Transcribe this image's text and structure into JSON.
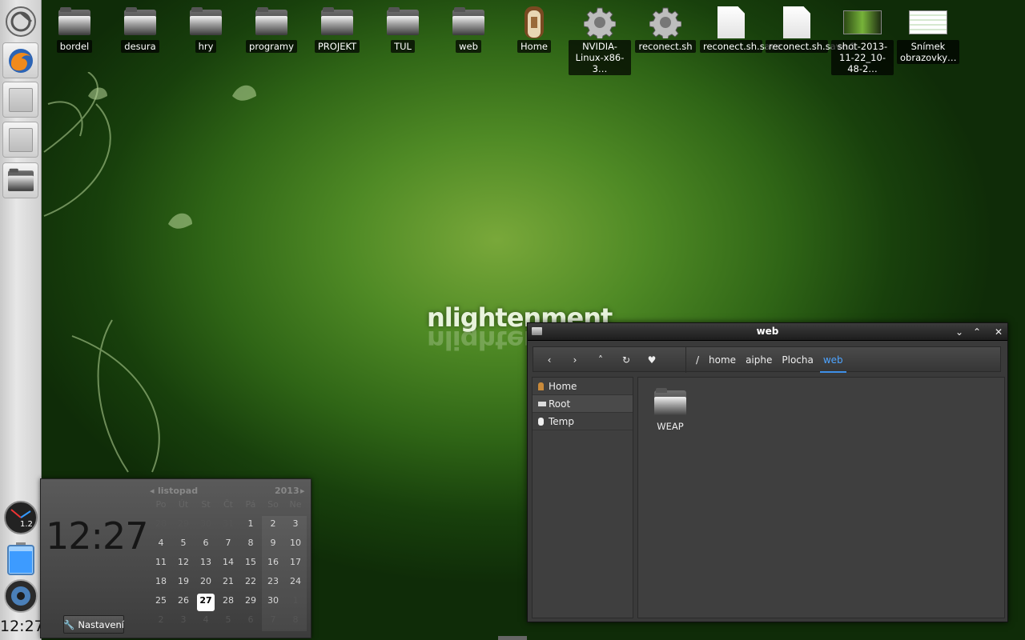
{
  "desktop": {
    "icons": [
      {
        "label": "bordel",
        "icon": "folder-icon"
      },
      {
        "label": "desura",
        "icon": "folder-icon"
      },
      {
        "label": "hry",
        "icon": "folder-icon"
      },
      {
        "label": "programy",
        "icon": "folder-icon"
      },
      {
        "label": "PROJEKT",
        "icon": "folder-icon"
      },
      {
        "label": "TUL",
        "icon": "folder-icon"
      },
      {
        "label": "web",
        "icon": "folder-icon"
      },
      {
        "label": "Home",
        "icon": "home-door-icon"
      },
      {
        "label": "NVIDIA-Linux-x86-3…",
        "icon": "gear-icon"
      },
      {
        "label": "reconect.sh",
        "icon": "gear-icon"
      },
      {
        "label": "reconect.sh.save",
        "icon": "document-icon"
      },
      {
        "label": "reconect.sh.save.1",
        "icon": "document-icon"
      },
      {
        "label": "shot-2013-11-22_10-48-2…",
        "icon": "image-thumbnail-icon"
      },
      {
        "label": "Snímek obrazovky…",
        "icon": "image-thumbnail-icon"
      }
    ],
    "wallpaper_logo": "nlightenment"
  },
  "shelf": {
    "items": [
      "enlightenment-start-icon",
      "firefox-icon",
      "window-placeholder-icon",
      "window-placeholder-icon",
      "file-manager-icon"
    ],
    "gadgets": {
      "cpufreq_value": "1.2"
    },
    "clock": "12:27"
  },
  "calendar": {
    "time": "12:27",
    "month": "listopad",
    "year": "2013",
    "weekdays": [
      "Po",
      "Út",
      "St",
      "Čt",
      "Pá",
      "So",
      "Ne"
    ],
    "weeks": [
      [
        "28",
        "29",
        "30",
        "31",
        "1",
        "2",
        "3"
      ],
      [
        "4",
        "5",
        "6",
        "7",
        "8",
        "9",
        "10"
      ],
      [
        "11",
        "12",
        "13",
        "14",
        "15",
        "16",
        "17"
      ],
      [
        "18",
        "19",
        "20",
        "21",
        "22",
        "23",
        "24"
      ],
      [
        "25",
        "26",
        "27",
        "28",
        "29",
        "30",
        "1"
      ],
      [
        "2",
        "3",
        "4",
        "5",
        "6",
        "7",
        "8"
      ]
    ],
    "today": "27",
    "settings_label": "Nastavení"
  },
  "file_manager": {
    "title": "web",
    "breadcrumbs": [
      "/",
      "home",
      "aiphe",
      "Plocha",
      "web"
    ],
    "sidebar": [
      {
        "label": "Home",
        "icon": "door-icon"
      },
      {
        "label": "Root",
        "icon": "drive-icon"
      },
      {
        "label": "Temp",
        "icon": "temp-icon"
      }
    ],
    "files": [
      {
        "label": "WEAP",
        "icon": "folder-icon"
      }
    ],
    "accent": "#4ea4ff"
  }
}
